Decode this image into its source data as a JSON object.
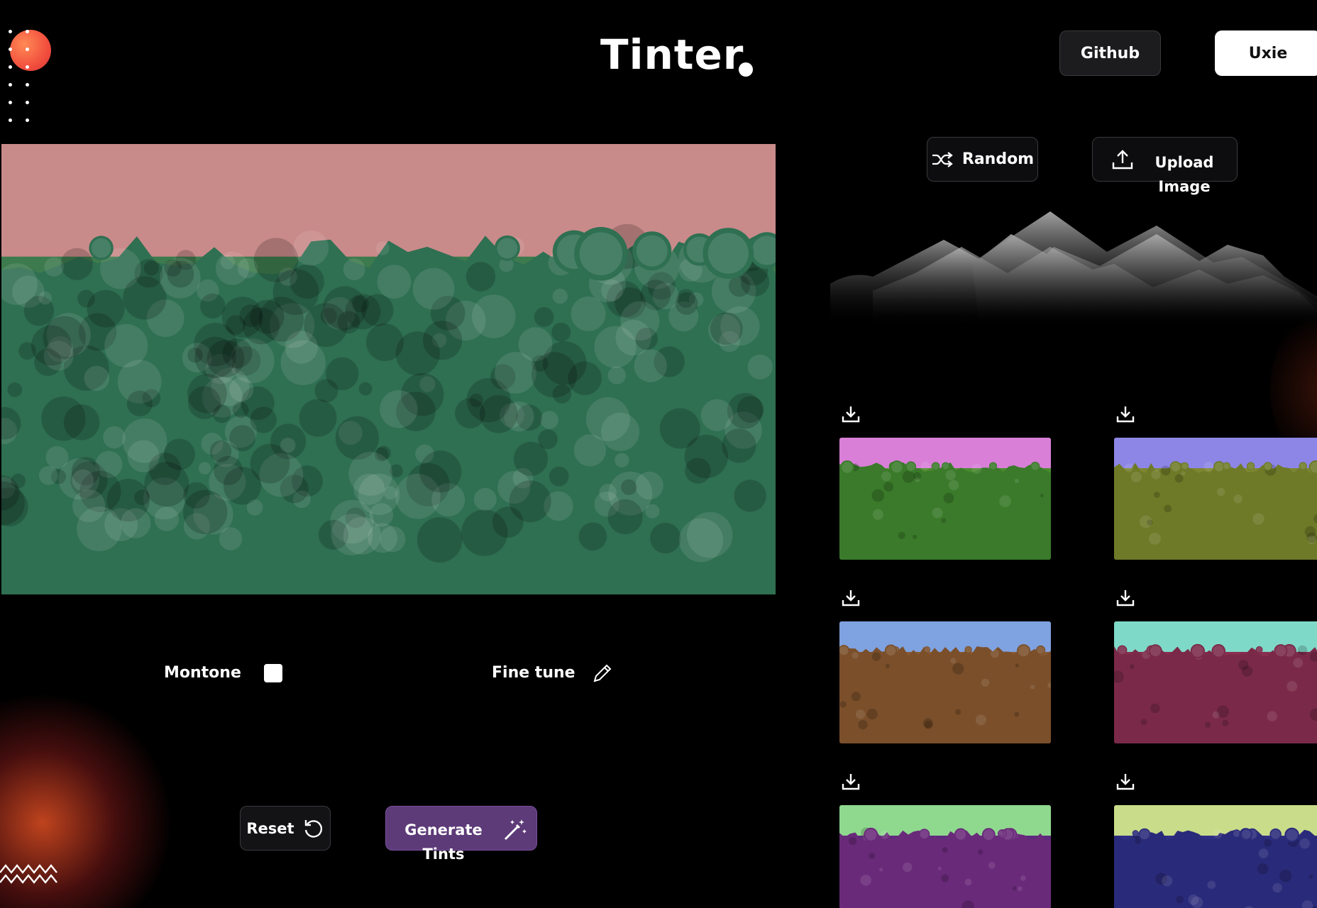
{
  "header": {
    "title": "Tinter",
    "github_label": "Github",
    "uxie_label": "Uxie"
  },
  "actions": {
    "random_label": "Random",
    "upload_label": "Upload Image"
  },
  "controls": {
    "monotone_label": "Montone",
    "monotone_checked": false,
    "fine_tune_label": "Fine tune",
    "reset_label": "Reset",
    "generate_label": "Generate Tints"
  },
  "main_image": {
    "sky_color": "#c98a8a",
    "foliage_color": "#2f6f52",
    "ground_color": "#3d7a4d"
  },
  "tints": [
    {
      "sky": "#d97fd8",
      "foliage": "#3a7a2a",
      "ground": "#4a8a2e"
    },
    {
      "sky": "#8d86e6",
      "foliage": "#6e7a28",
      "ground": "#7d8630"
    },
    {
      "sky": "#7fa2e0",
      "foliage": "#7a4f2a",
      "ground": "#8a5a32"
    },
    {
      "sky": "#7fd9c8",
      "foliage": "#7a2a48",
      "ground": "#8a2e50"
    },
    {
      "sky": "#8fd98f",
      "foliage": "#6a2a7a",
      "ground": "#5e2a7e"
    },
    {
      "sky": "#c9dc8a",
      "foliage": "#2a2a7a",
      "ground": "#2e2e86"
    }
  ],
  "icons": {
    "random": "shuffle-icon",
    "upload": "upload-icon",
    "fine_tune": "pencil-icon",
    "reset": "reset-icon",
    "generate": "magic-wand-icon",
    "download": "download-icon"
  }
}
